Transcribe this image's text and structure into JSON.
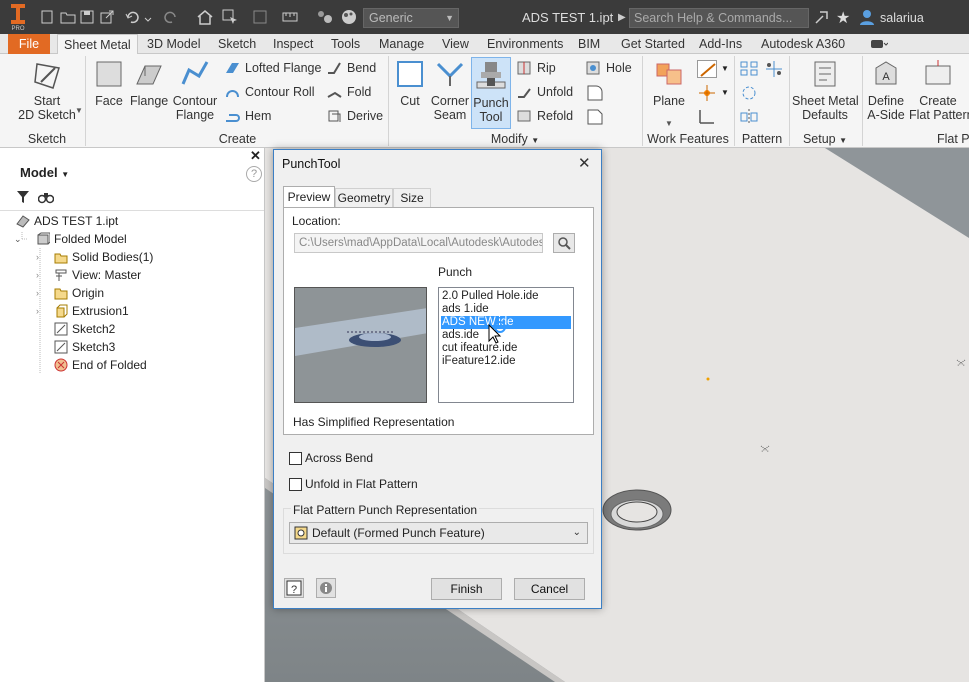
{
  "app": {
    "title": "ADS TEST 1.ipt",
    "appearance": "Generic",
    "search_placeholder": "Search Help & Commands...",
    "user": "salariua"
  },
  "ribbon_tabs": [
    "File",
    "Sheet Metal",
    "3D Model",
    "Sketch",
    "Inspect",
    "Tools",
    "Manage",
    "View",
    "Environments",
    "BIM",
    "Get Started",
    "Add-Ins",
    "Autodesk A360"
  ],
  "ribbon": {
    "start_sketch": "Start\n2D Sketch",
    "face": "Face",
    "flange": "Flange",
    "contour_flange": "Contour\nFlange",
    "lofted_flange": "Lofted Flange",
    "contour_roll": "Contour Roll",
    "hem": "Hem",
    "bend": "Bend",
    "fold": "Fold",
    "derive": "Derive",
    "cut": "Cut",
    "corner_seam": "Corner\nSeam",
    "punch_tool": "Punch\nTool",
    "rip": "Rip",
    "unfold": "Unfold",
    "refold": "Refold",
    "hole": "Hole",
    "plane": "Plane",
    "sheet_metal_defaults": "Sheet Metal\nDefaults",
    "define_a_side": "Define\nA-Side",
    "create_flat_pattern": "Create\nFlat Pattern",
    "groups": {
      "sketch": "Sketch",
      "create": "Create",
      "modify": "Modify",
      "work_features": "Work Features",
      "pattern": "Pattern",
      "setup": "Setup",
      "flat": "Flat P"
    }
  },
  "browser": {
    "title": "Model",
    "root": "ADS TEST 1.ipt",
    "items": [
      "Folded Model",
      "Solid Bodies(1)",
      "View: Master",
      "Origin",
      "Extrusion1",
      "Sketch2",
      "Sketch3",
      "End of Folded"
    ]
  },
  "dialog": {
    "title": "PunchTool",
    "tabs": [
      "Preview",
      "Geometry",
      "Size"
    ],
    "location_label": "Location:",
    "location_value": "C:\\Users\\mad\\AppData\\Local\\Autodesk\\Autodesk S",
    "punch_label": "Punch",
    "punch_items": [
      "2.0 Pulled Hole.ide",
      "ads 1.ide",
      "ADS NEW.ide",
      "ads.ide",
      "cut ifeature.ide",
      "iFeature12.ide"
    ],
    "selected_index": 2,
    "simplified_label": "Has Simplified Representation",
    "across_bend": "Across Bend",
    "unfold_flat": "Unfold in Flat Pattern",
    "flat_pattern_label": "Flat Pattern Punch Representation",
    "flat_pattern_value": "Default (Formed Punch Feature)",
    "finish": "Finish",
    "cancel": "Cancel"
  },
  "colors": {
    "accent": "#e26a23",
    "selection": "#3399ff",
    "dialog_border": "#3c7fc4"
  }
}
